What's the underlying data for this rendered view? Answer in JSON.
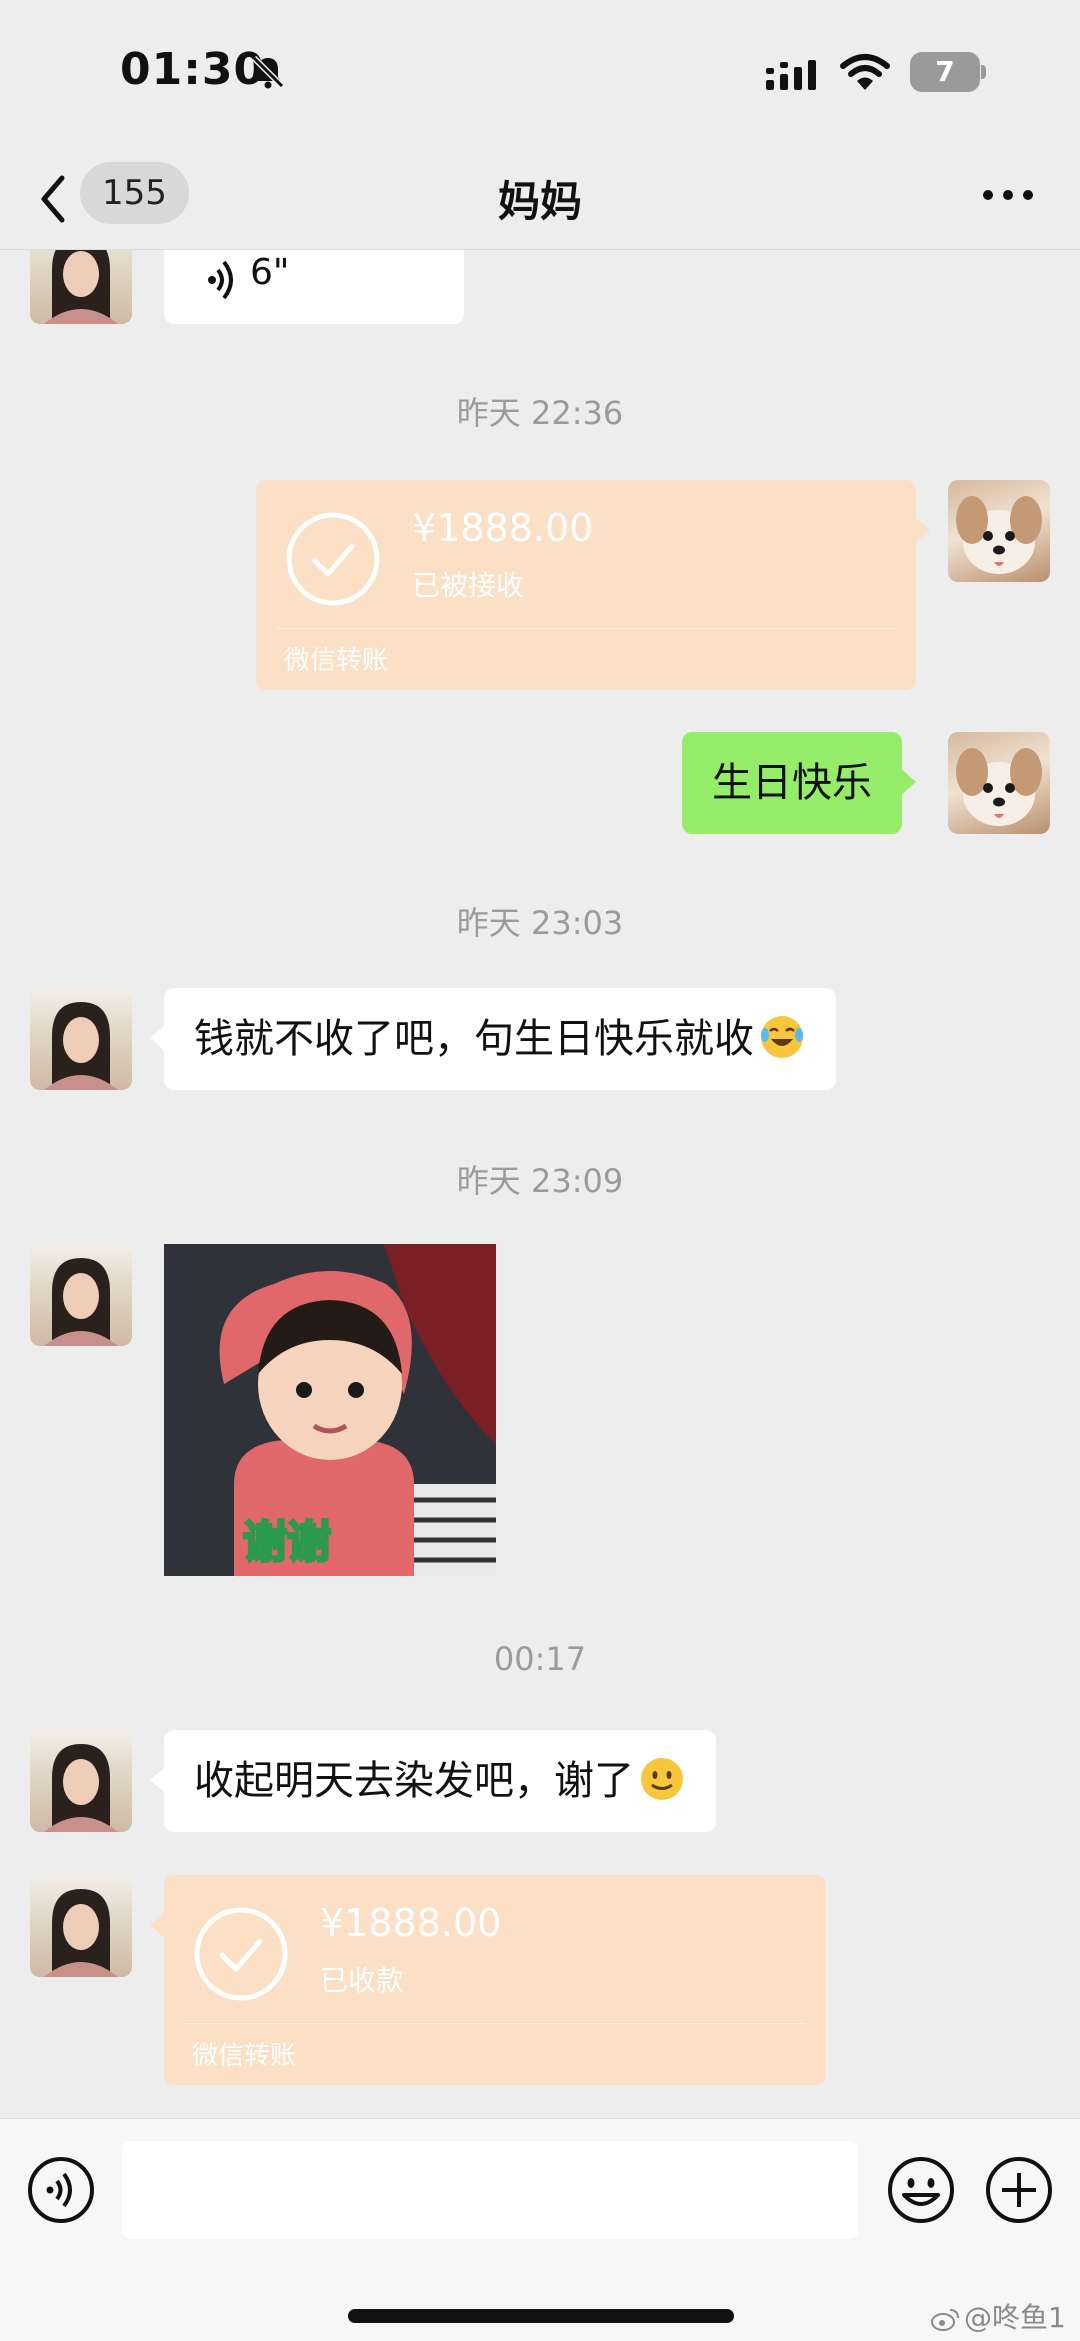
{
  "status_bar": {
    "time": "01:30",
    "battery": "7",
    "icons": [
      "mute-icon",
      "signal-icon",
      "wifi-icon",
      "battery-icon"
    ]
  },
  "nav": {
    "unread_count": "155",
    "title": "妈妈",
    "icons": [
      "back-icon",
      "more-icon"
    ]
  },
  "messages": {
    "voice": {
      "duration": "6\""
    },
    "ts1": "昨天 22:36",
    "transfer_sent": {
      "amount": "¥1888.00",
      "status": "已被接收",
      "footer": "微信转账"
    },
    "text_birthday": "生日快乐",
    "ts2": "昨天 23:03",
    "text_mom1": "钱就不收了吧，句生日快乐就收",
    "ts3": "昨天 23:09",
    "sticker": {
      "caption": "谢谢"
    },
    "ts4": "00:17",
    "text_mom2": "收起明天去染发吧，谢了",
    "transfer_recv": {
      "amount": "¥1888.00",
      "status": "已收款",
      "footer": "微信转账"
    }
  },
  "input_bar": {
    "placeholder": "",
    "icons": [
      "voice-toggle-icon",
      "emoji-icon",
      "add-icon"
    ]
  },
  "watermark": "@咚鱼1",
  "colors": {
    "background": "#ededed",
    "sent_bubble": "#95ec69",
    "received_bubble": "#ffffff",
    "transfer_bubble": "#fbe0c5",
    "timestamp": "#9b9b9b"
  }
}
